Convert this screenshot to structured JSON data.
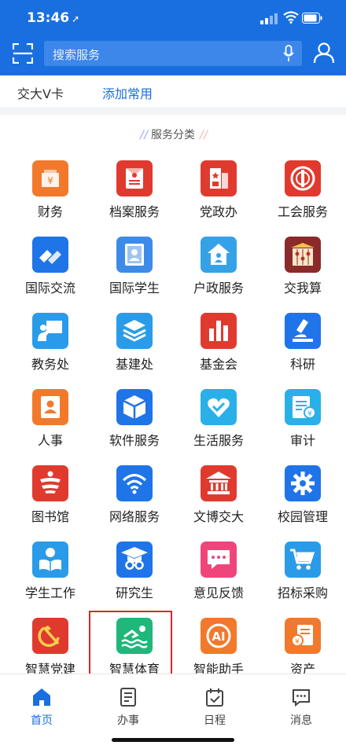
{
  "status": {
    "time": "13:46",
    "arrow": "➚"
  },
  "search": {
    "placeholder": "搜索服务"
  },
  "quick": {
    "card": "交大V卡",
    "add": "添加常用"
  },
  "section": {
    "title": "服务分类",
    "deco_left": "/ /",
    "deco_right": "/ /"
  },
  "services": [
    {
      "label": "财务",
      "icon": "finance-icon",
      "color": "#f2792b"
    },
    {
      "label": "档案服务",
      "icon": "archive-icon",
      "color": "#e03a2f"
    },
    {
      "label": "党政办",
      "icon": "party-office-icon",
      "color": "#e03a2f"
    },
    {
      "label": "工会服务",
      "icon": "union-icon",
      "color": "#e03a2f"
    },
    {
      "label": "国际交流",
      "icon": "handshake-icon",
      "color": "#1f74e8"
    },
    {
      "label": "国际学生",
      "icon": "intl-student-icon",
      "color": "#3d8be8"
    },
    {
      "label": "户政服务",
      "icon": "household-icon",
      "color": "#35a2e8"
    },
    {
      "label": "交我算",
      "icon": "abacus-icon",
      "color": "#8a2a2a"
    },
    {
      "label": "教务处",
      "icon": "teaching-icon",
      "color": "#2a9be8"
    },
    {
      "label": "基建处",
      "icon": "layers-icon",
      "color": "#2a9be8"
    },
    {
      "label": "基金会",
      "icon": "bar-chart-icon",
      "color": "#e03a2f"
    },
    {
      "label": "科研",
      "icon": "microscope-icon",
      "color": "#1f74e8"
    },
    {
      "label": "人事",
      "icon": "person-card-icon",
      "color": "#f2792b"
    },
    {
      "label": "软件服务",
      "icon": "cube-icon",
      "color": "#1f74e8"
    },
    {
      "label": "生活服务",
      "icon": "heart-icon",
      "color": "#2ab0e8"
    },
    {
      "label": "审计",
      "icon": "audit-icon",
      "color": "#2ab0e8"
    },
    {
      "label": "图书馆",
      "icon": "library-icon",
      "color": "#e03a2f"
    },
    {
      "label": "网络服务",
      "icon": "wifi-icon",
      "color": "#1f74e8"
    },
    {
      "label": "文博交大",
      "icon": "museum-icon",
      "color": "#e03a2f"
    },
    {
      "label": "校园管理",
      "icon": "gear-icon",
      "color": "#1f74e8"
    },
    {
      "label": "学生工作",
      "icon": "student-work-icon",
      "color": "#2a9be8"
    },
    {
      "label": "研究生",
      "icon": "graduate-icon",
      "color": "#1f74e8"
    },
    {
      "label": "意见反馈",
      "icon": "feedback-icon",
      "color": "#f0457a"
    },
    {
      "label": "招标采购",
      "icon": "cart-icon",
      "color": "#2a9be8"
    },
    {
      "label": "智慧党建",
      "icon": "hammer-sickle-icon",
      "color": "#e03a2f"
    },
    {
      "label": "智慧体育",
      "icon": "swim-icon",
      "color": "#1fb87a"
    },
    {
      "label": "智能助手",
      "icon": "ai-icon",
      "color": "#f2792b"
    },
    {
      "label": "资产",
      "icon": "assets-icon",
      "color": "#f2792b"
    }
  ],
  "tabs": [
    {
      "label": "首页",
      "icon": "home-icon",
      "active": true
    },
    {
      "label": "办事",
      "icon": "document-icon",
      "active": false
    },
    {
      "label": "日程",
      "icon": "calendar-icon",
      "active": false
    },
    {
      "label": "消息",
      "icon": "message-icon",
      "active": false
    }
  ],
  "colors": {
    "primary": "#1a6fe0",
    "highlight": "#e0242a"
  }
}
